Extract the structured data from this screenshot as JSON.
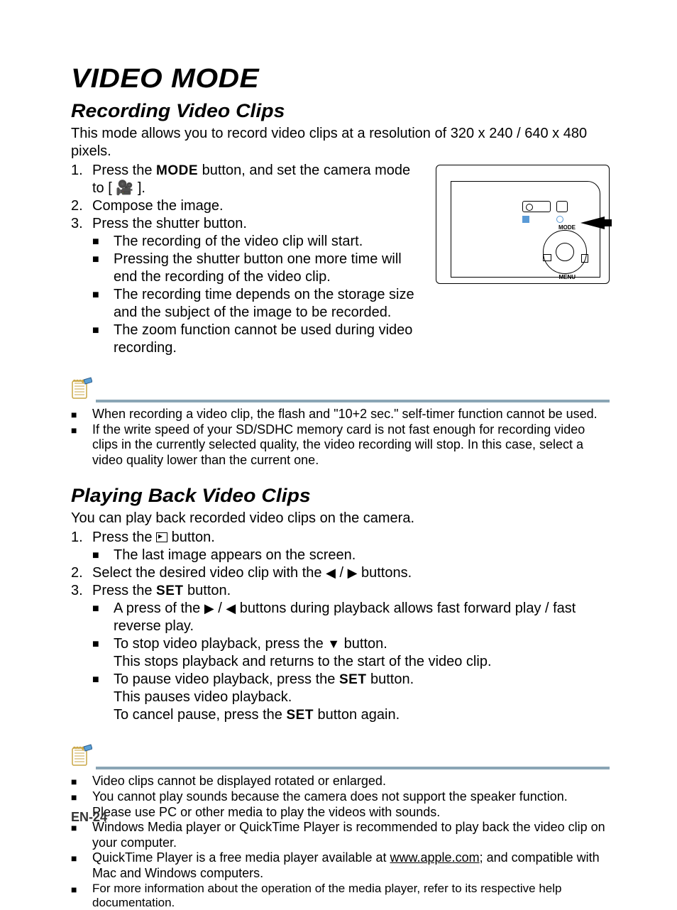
{
  "page_title": "VIDEO MODE",
  "section1": {
    "heading": "Recording Video Clips",
    "intro": "This mode allows you to record video clips at a resolution of 320 x 240 / 640 x 480 pixels.",
    "steps": [
      {
        "num": "1.",
        "pre": "Press the ",
        "btn": "MODE",
        "post": " button, and set the camera mode to [ ",
        "icon": "video-mode-icon",
        "post2": " ]."
      },
      {
        "num": "2.",
        "text": "Compose the image."
      },
      {
        "num": "3.",
        "text": "Press the shutter button."
      }
    ],
    "sub_bullets": [
      "The recording of the video clip will start.",
      "Pressing the shutter button one more time will end the recording of the video clip.",
      "The recording time depends on the storage size and the subject of the image to be recorded.",
      "The zoom function cannot be used during video recording."
    ],
    "notes": [
      "When recording a video clip, the flash and \"10+2 sec.\" self-timer function cannot be used.",
      "If the write speed of your SD/SDHC memory card is not fast enough for recording video clips in the  currently selected quality, the video recording will stop. In this case, select a video quality lower than the current one."
    ]
  },
  "section2": {
    "heading": "Playing Back Video Clips",
    "intro": "You can play back recorded video clips on the camera.",
    "step1_num": "1.",
    "step1_pre": "Press the ",
    "step1_post": " button.",
    "step1_sub": "The last image appears on the screen.",
    "step2_num": "2.",
    "step2_pre": "Select the desired video clip with the ",
    "step2_post": " buttons.",
    "step3_num": "3.",
    "step3_pre": "Press the ",
    "step3_btn": "SET",
    "step3_post": " button.",
    "s3b1_pre": "A press of the ",
    "s3b1_post": " buttons during playback allows fast forward play / fast reverse play.",
    "s3b2_pre": "To stop video playback, press the ",
    "s3b2_post": " button.",
    "s3b2_line2": "This stops playback and returns to the start of the video clip.",
    "s3b3_pre": "To pause video playback, press the ",
    "s3b3_btn": "SET",
    "s3b3_post": " button.",
    "s3b3_line2": "This pauses video playback.",
    "s3b3_line3_pre": "To cancel pause, press the ",
    "s3b3_line3_btn": "SET",
    "s3b3_line3_post": " button again.",
    "notes": [
      "Video clips cannot be displayed rotated or enlarged.",
      "You cannot play sounds because the camera does not support the speaker function. Please use PC or other media to play the videos with sounds.",
      "Windows Media player or QuickTime Player is recommended to play back the video clip on your computer."
    ],
    "note4_pre": "QuickTime Player is a free media player available at ",
    "note4_link": "www.apple.com",
    "note4_post": "; and compatible with Mac and Windows computers.",
    "note5": "For more information about the operation of the media player, refer to its respective help documentation."
  },
  "figure": {
    "mode_label": "MODE",
    "menu_label": "MENU"
  },
  "page_number": "EN-24"
}
